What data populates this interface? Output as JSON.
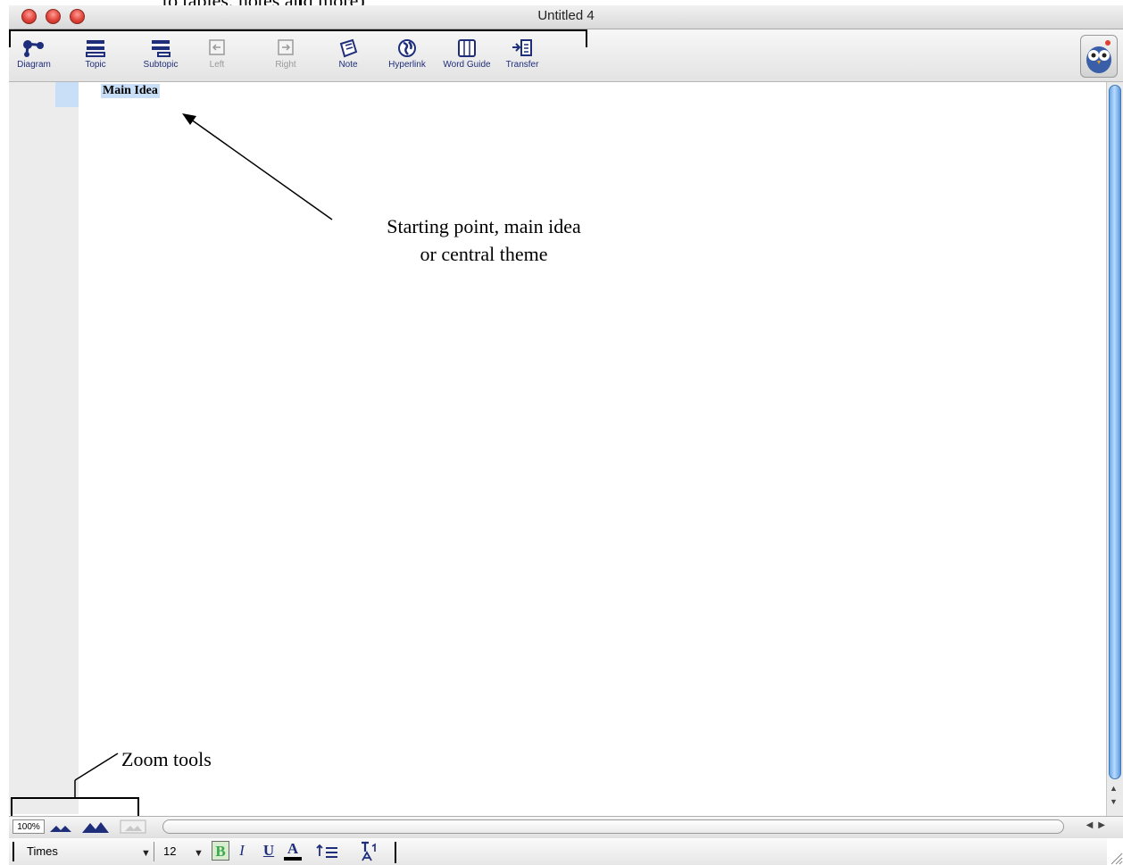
{
  "annotations": {
    "top": "to tables, notes and more)",
    "center_line1": "Starting point, main idea",
    "center_line2": "or central theme",
    "zoom": "Zoom tools"
  },
  "window": {
    "title": "Untitled 4"
  },
  "toolbar": {
    "buttons": [
      {
        "label": "Diagram",
        "icon": "diagram-icon",
        "enabled": true
      },
      {
        "label": "Topic",
        "icon": "topic-icon",
        "enabled": true
      },
      {
        "label": "Subtopic",
        "icon": "subtopic-icon",
        "enabled": true
      },
      {
        "label": "Left",
        "icon": "arrow-left-icon",
        "enabled": false
      },
      {
        "label": "Right",
        "icon": "arrow-right-icon",
        "enabled": false
      },
      {
        "label": "Note",
        "icon": "note-icon",
        "enabled": true
      },
      {
        "label": "Hyperlink",
        "icon": "globe-icon",
        "enabled": true
      },
      {
        "label": "Word Guide",
        "icon": "book-icon",
        "enabled": true
      },
      {
        "label": "Transfer",
        "icon": "transfer-icon",
        "enabled": true
      }
    ]
  },
  "document": {
    "main_idea": "Main Idea"
  },
  "zoom": {
    "value": "100%"
  },
  "format": {
    "font": "Times",
    "size": "12"
  },
  "colors": {
    "accent": "#1f2e7a",
    "selection": "#c9dff7",
    "scroll_thumb": "#6aa7e6"
  }
}
